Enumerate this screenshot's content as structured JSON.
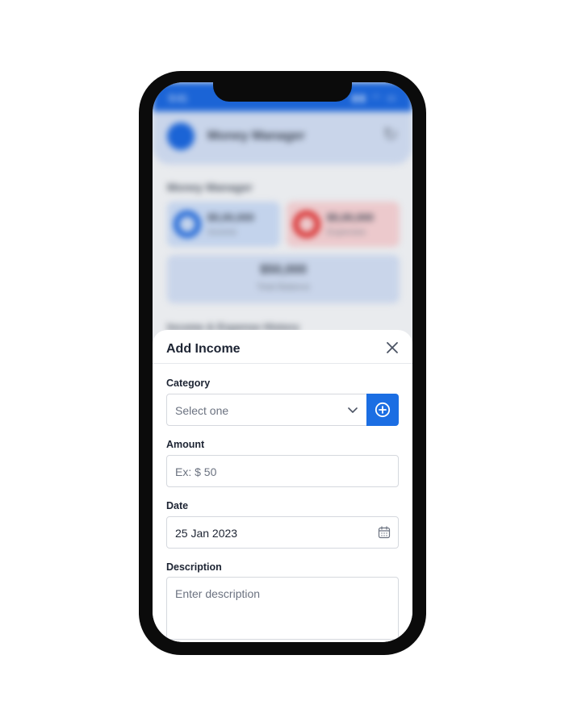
{
  "background_app": {
    "status_time": "9:41",
    "header_title": "Money Manager",
    "section_title": "Money Manager",
    "income_value": "$5,00,000",
    "income_label": "Income",
    "expense_value": "$5,00,000",
    "expense_label": "Expenses",
    "balance_value": "$50,000",
    "balance_label": "Total Balance",
    "history_title": "Income & Expense History"
  },
  "modal": {
    "title": "Add Income",
    "category": {
      "label": "Category",
      "placeholder": "Select one"
    },
    "amount": {
      "label": "Amount",
      "placeholder": "Ex: $ 50"
    },
    "date": {
      "label": "Date",
      "value": "25 Jan 2023"
    },
    "description": {
      "label": "Description",
      "placeholder": "Enter description"
    }
  },
  "colors": {
    "accent": "#1b6ee3",
    "expense": "#d92d2d"
  },
  "icons": [
    "close-icon",
    "chevron-down-icon",
    "add-circle-icon",
    "calendar-icon",
    "refresh-icon"
  ]
}
